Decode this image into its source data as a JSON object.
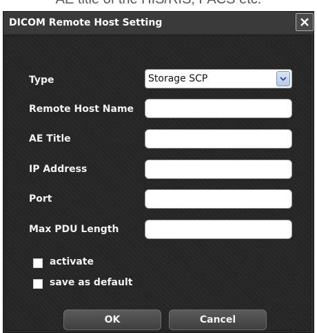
{
  "background_caption": "AE title of the HIS/RIS, PACS etc.",
  "dialog": {
    "title": "DICOM Remote Host Setting",
    "close_icon": "close-icon"
  },
  "form": {
    "type_label": "Type",
    "type_value": "Storage SCP",
    "remote_host_name_label": "Remote Host Name",
    "remote_host_name_value": "",
    "ae_title_label": "AE Title",
    "ae_title_value": "",
    "ip_address_label": "IP Address",
    "ip_address_value": "",
    "port_label": "Port",
    "port_value": "",
    "max_pdu_length_label": "Max PDU Length",
    "max_pdu_length_value": ""
  },
  "options": {
    "activate_label": "activate",
    "activate_checked": false,
    "save_default_label": "save as default",
    "save_default_checked": false
  },
  "buttons": {
    "ok_label": "OK",
    "cancel_label": "Cancel"
  },
  "colors": {
    "dialog_background": "#262626",
    "titlebar": "#3a3a3a",
    "text": "#f2f2f2",
    "dropdown_arrow": "#b8c9e6"
  }
}
